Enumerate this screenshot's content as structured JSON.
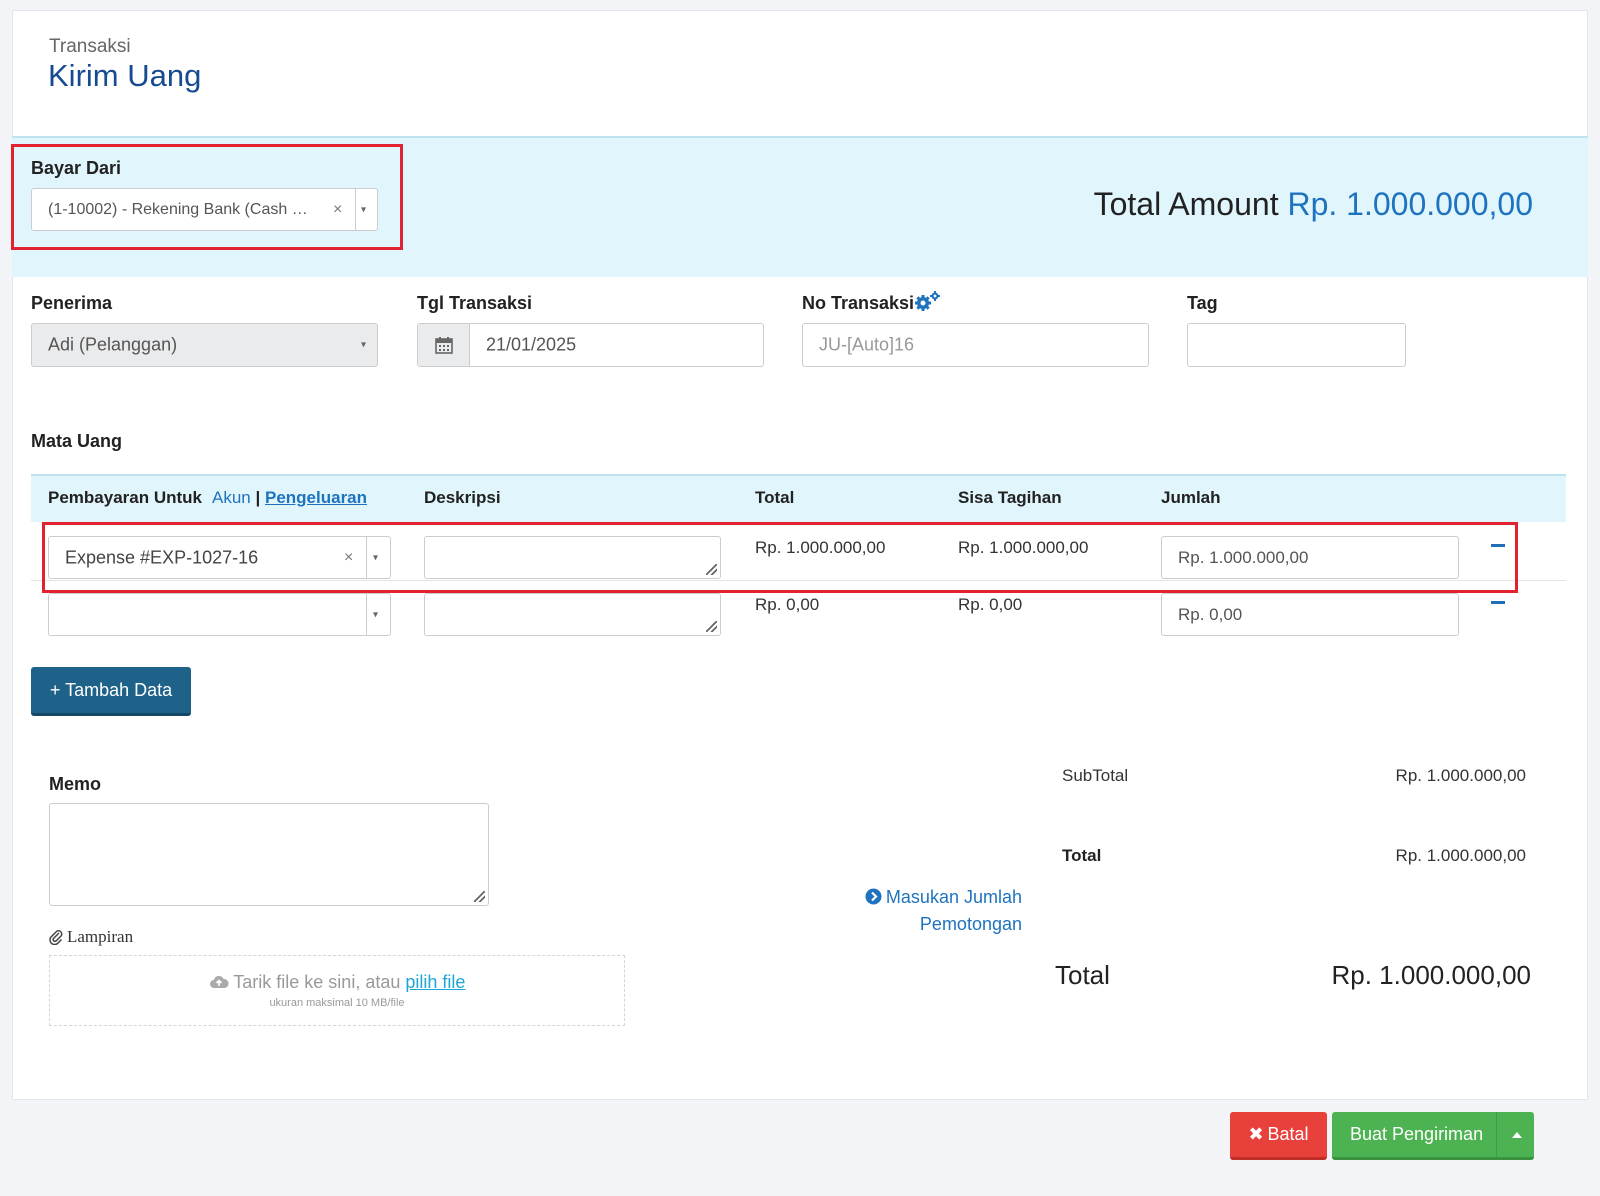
{
  "header": {
    "subtitle": "Transaksi",
    "title": "Kirim Uang"
  },
  "bayar_dari": {
    "label": "Bayar Dari",
    "value": "(1-10002) - Rekening Bank (Cash &...",
    "clear": "×",
    "caret": "▾"
  },
  "total_amount": {
    "label": "Total Amount",
    "value": "Rp. 1.000.000,00"
  },
  "penerima": {
    "label": "Penerima",
    "value": "Adi (Pelanggan)",
    "caret": "▾"
  },
  "tgl_transaksi": {
    "label": "Tgl Transaksi",
    "value": "21/01/2025"
  },
  "no_transaksi": {
    "label": "No Transaksi",
    "placeholder": "JU-[Auto]16"
  },
  "tag": {
    "label": "Tag"
  },
  "mata_uang": {
    "label": "Mata Uang"
  },
  "table": {
    "col_pembayaran": "Pembayaran Untuk",
    "link_akun": "Akun",
    "link_sep": "|",
    "link_pengeluaran": "Pengeluaran",
    "col_deskripsi": "Deskripsi",
    "col_total": "Total",
    "col_sisa": "Sisa Tagihan",
    "col_jumlah": "Jumlah",
    "rows": [
      {
        "item": "Expense #EXP-1027-16",
        "total": "Rp. 1.000.000,00",
        "sisa": "Rp. 1.000.000,00",
        "jumlah": "Rp. 1.000.000,00"
      },
      {
        "item": "",
        "total": "Rp. 0,00",
        "sisa": "Rp. 0,00",
        "jumlah": "Rp. 0,00"
      }
    ]
  },
  "add_button": "+ Tambah Data",
  "memo": {
    "label": "Memo"
  },
  "lampiran": {
    "label": "Lampiran",
    "drop_text": "Tarik file ke sini, atau",
    "drop_link": "pilih file",
    "drop_hint": "ukuran maksimal 10 MB/file"
  },
  "summary": {
    "subtotal_label": "SubTotal",
    "subtotal_value": "Rp. 1.000.000,00",
    "total_label": "Total",
    "total_value": "Rp. 1.000.000,00",
    "deduction_link_1": "Masukan Jumlah",
    "deduction_link_2": "Pemotongan",
    "grand_label": "Total",
    "grand_value": "Rp. 1.000.000,00"
  },
  "footer": {
    "cancel": "Batal",
    "submit": "Buat Pengiriman"
  },
  "colors": {
    "accent": "#1e73be",
    "title": "#174b8f",
    "highlight": "#e32230",
    "band": "#e1f5fc"
  }
}
